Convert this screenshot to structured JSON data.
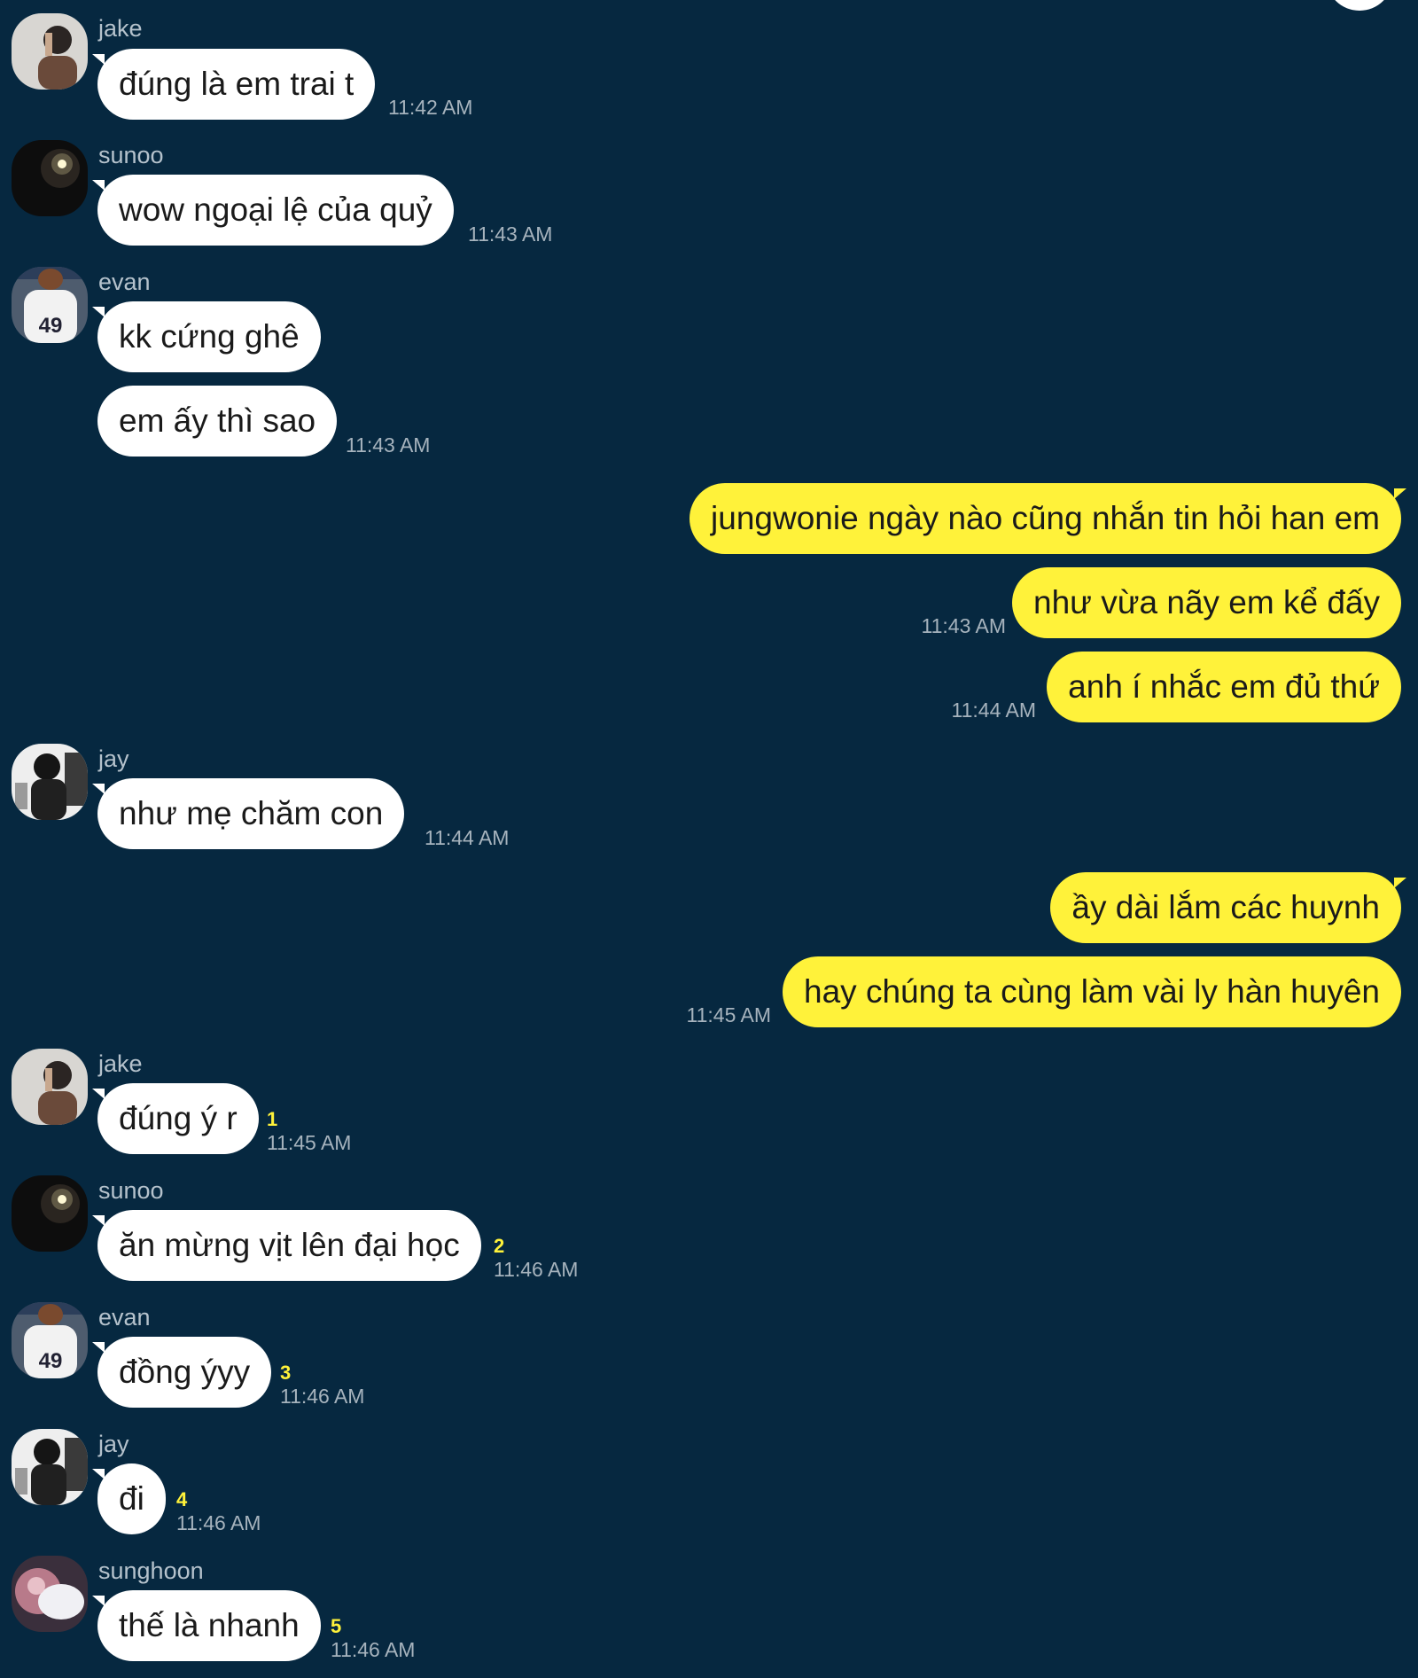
{
  "colors": {
    "background": "#062840",
    "incoming_bubble": "#ffffff",
    "outgoing_bubble": "#fff23a",
    "unread_count": "#fff23a",
    "timestamp": "#a6b3bd"
  },
  "messages": [
    {
      "id": "m1",
      "side": "in",
      "sender": "jake",
      "text": "đúng là em trai t",
      "time": "11:42 AM"
    },
    {
      "id": "m2",
      "side": "in",
      "sender": "sunoo",
      "text": "wow ngoại lệ của quỷ",
      "time": "11:43 AM"
    },
    {
      "id": "m3",
      "side": "in",
      "sender": "evan",
      "text": "kk cứng ghê"
    },
    {
      "id": "m4",
      "side": "in",
      "text": "em ấy thì sao",
      "time": "11:43 AM"
    },
    {
      "id": "m5",
      "side": "out",
      "text": "jungwonie ngày nào cũng nhắn tin hỏi han em"
    },
    {
      "id": "m6",
      "side": "out",
      "text": "như vừa nãy em kể đấy",
      "time": "11:43 AM"
    },
    {
      "id": "m7",
      "side": "out",
      "text": "anh í nhắc em đủ thứ",
      "time": "11:44 AM"
    },
    {
      "id": "m8",
      "side": "in",
      "sender": "jay",
      "text": "như mẹ chăm con",
      "time": "11:44 AM"
    },
    {
      "id": "m9",
      "side": "out",
      "text": "ầy dài lắm các huynh"
    },
    {
      "id": "m10",
      "side": "out",
      "text": "hay chúng ta cùng làm vài ly hàn huyên",
      "time": "11:45 AM"
    },
    {
      "id": "m11",
      "side": "in",
      "sender": "jake",
      "text": "đúng ý r",
      "count": "1",
      "time": "11:45 AM"
    },
    {
      "id": "m12",
      "side": "in",
      "sender": "sunoo",
      "text": "ăn mừng vịt lên đại học",
      "count": "2",
      "time": "11:46 AM"
    },
    {
      "id": "m13",
      "side": "in",
      "sender": "evan",
      "text": "đồng ýyy",
      "count": "3",
      "time": "11:46 AM"
    },
    {
      "id": "m14",
      "side": "in",
      "sender": "jay",
      "text": "đi",
      "count": "4",
      "time": "11:46 AM"
    },
    {
      "id": "m15",
      "side": "in",
      "sender": "sunghoon",
      "text": "thế là nhanh",
      "count": "5",
      "time": "11:46 AM"
    }
  ]
}
